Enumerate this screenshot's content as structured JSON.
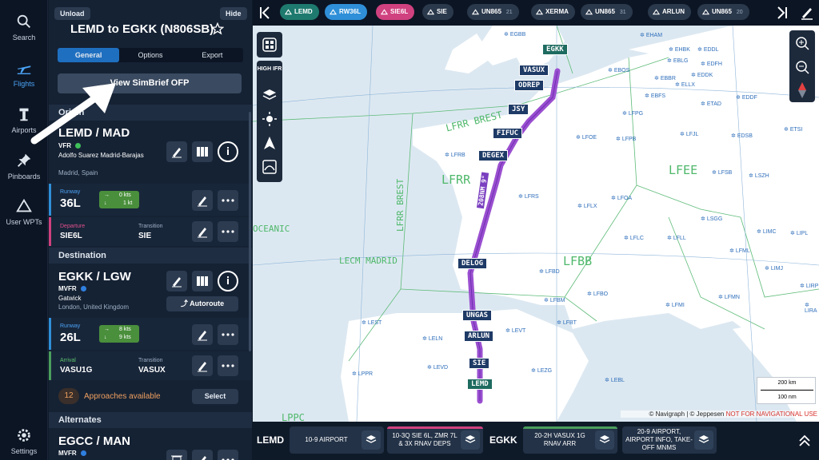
{
  "nav": {
    "items": [
      {
        "label": "Search",
        "icon": "search-icon"
      },
      {
        "label": "Flights",
        "icon": "plane-icon",
        "active": true
      },
      {
        "label": "Airports",
        "icon": "tower-icon"
      },
      {
        "label": "Pinboards",
        "icon": "pin-icon"
      },
      {
        "label": "User WPTs",
        "icon": "triangle-icon"
      }
    ],
    "settings_label": "Settings"
  },
  "panel": {
    "unload_label": "Unload",
    "hide_label": "Hide",
    "route_title": "LEMD to EGKK (N806SB)",
    "tabs": [
      "General",
      "Options",
      "Export"
    ],
    "simbrief_label": "View SimBrief OFP",
    "origin_head": "Origin",
    "origin": {
      "code": "LEMD / MAD",
      "flight_rules": "VFR",
      "name": "Adolfo Suarez Madrid-Barajas",
      "location": "Madrid, Spain",
      "runway_label": "Runway",
      "runway": "36L",
      "wind_head": "0 kts",
      "wind_cross": "1 kt",
      "departure_label": "Departure",
      "departure": "SIE6L",
      "transition_label": "Transition",
      "transition": "SIE"
    },
    "destination_head": "Destination",
    "destination": {
      "code": "EGKK / LGW",
      "flight_rules": "MVFR",
      "name": "Gatwick",
      "location": "London, United Kingdom",
      "autoroute_label": "Autoroute",
      "runway_label": "Runway",
      "runway": "26L",
      "wind_head": "8 kts",
      "wind_cross": "9 kts",
      "arrival_label": "Arrival",
      "arrival": "VASU1G",
      "transition_label": "Transition",
      "transition": "VASUX",
      "approaches_count": "12",
      "approaches_label": "Approaches available",
      "select_label": "Select"
    },
    "alternates_head": "Alternates",
    "alternate": {
      "code": "EGCC / MAN",
      "flight_rules": "MVFR"
    }
  },
  "topbar": {
    "chips": [
      {
        "label": "LEMD",
        "num": "",
        "color": "#1e7a6e"
      },
      {
        "label": "RW36L",
        "num": "",
        "color": "#2f8fd8"
      },
      {
        "label": "SIE6L",
        "num": "",
        "color": "#d0417f"
      },
      {
        "label": "SIE",
        "num": "",
        "color": "#2b394c"
      },
      {
        "label": "UN865",
        "num": "21",
        "color": "#2b394c"
      },
      {
        "label": "XERMA",
        "num": "",
        "color": "#2b394c"
      },
      {
        "label": "UN865",
        "num": "31",
        "color": "#2b394c"
      },
      {
        "label": "ARLUN",
        "num": "",
        "color": "#2b394c"
      },
      {
        "label": "UN865",
        "num": "20",
        "color": "#2b394c"
      }
    ]
  },
  "map": {
    "fixes": [
      {
        "label": "EGKK",
        "green": true
      },
      {
        "label": "VASUX"
      },
      {
        "label": "ODREP"
      },
      {
        "label": "JSY"
      },
      {
        "label": "FIFUC"
      },
      {
        "label": "DEGEX"
      },
      {
        "label": "DELOG"
      },
      {
        "label": "UNGAS"
      },
      {
        "label": "ARLUN"
      },
      {
        "label": "SIE"
      },
      {
        "label": "LEMD",
        "green": true
      }
    ],
    "route_label": "208NM 9°",
    "fir_labels": [
      "LFRR BREST",
      "LFRR BREST",
      "LFRR",
      "LFEE",
      "LFBB",
      "LECM MADRID",
      "OCEANIC",
      "LPPC"
    ],
    "airports": [
      "EGBB",
      "EHAM",
      "EBBR",
      "EBOS",
      "EBLG",
      "EDDL",
      "EDDK",
      "ELLX",
      "EDDF",
      "EDFH",
      "EBFS",
      "ETAD",
      "EHBK",
      "LFPG",
      "LFPB",
      "LFOE",
      "LFJL",
      "EDSB",
      "ETSI",
      "LFSB",
      "LSZH",
      "LFRB",
      "LFRS",
      "LFLX",
      "LFOA",
      "LFLC",
      "LFLL",
      "LSGG",
      "LFMI",
      "LIMC",
      "LIPL",
      "LFBD",
      "LFBO",
      "LFBM",
      "LFBT",
      "LFMN",
      "LFML",
      "LIMJ",
      "LEST",
      "LELN",
      "LEVT",
      "LEVD",
      "LEZG",
      "LEBL",
      "LPPR",
      "LIRP",
      "LIRA"
    ],
    "scale_km": "200 km",
    "scale_nm": "100 nm",
    "credit": "© Navigraph | © Jeppesen",
    "credit_warning": "NOT FOR NAVIGATIONAL USE",
    "layer_toggle": "HIGH IFR"
  },
  "bottombar": {
    "origin_code": "LEMD",
    "dest_code": "EGKK",
    "cards": [
      {
        "text": "10-9 AIRPORT",
        "bar": ""
      },
      {
        "text": "10-3Q SIE 6L, ZMR 7L & 3X RNAV DEPS",
        "bar": "#d0417f"
      },
      {
        "text": "20-2H VASUX 1G RNAV ARR",
        "bar": "#4a9f5c"
      },
      {
        "text": "20-9 AIRPORT, AIRPORT INFO, TAKE-OFF MNMS",
        "bar": ""
      }
    ]
  }
}
